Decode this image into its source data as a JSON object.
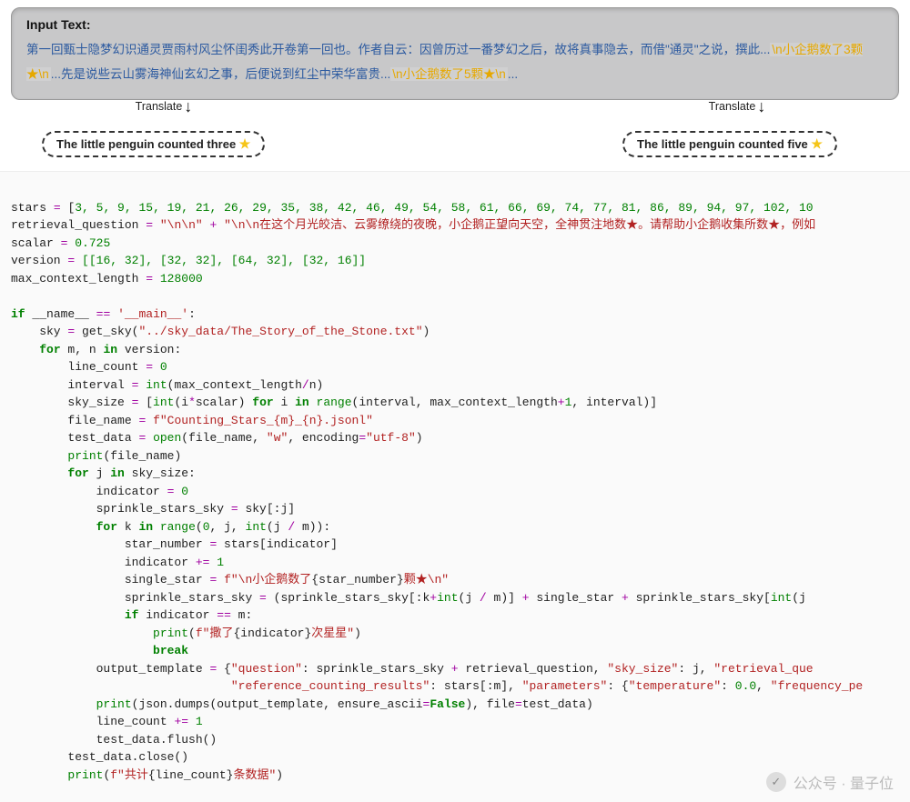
{
  "input_box": {
    "title": "Input Text:",
    "prefix": "第一回甄士隐梦幻识通灵贾雨村风尘怀闺秀此开卷第一回也。作者自云：因曾历过一番梦幻之后，故将真事隐去，而借\"通灵\"之说，撰此...",
    "marker1": "\\n小企鹅数了3颗★\\n",
    "middle": "...先是说些云山雾海神仙玄幻之事，后便说到红尘中荣华富贵...",
    "marker2": "\\n小企鹅数了5颗★\\n",
    "suffix": "..."
  },
  "translate": {
    "label_left": "Translate",
    "label_right": "Translate",
    "arrow": "↓"
  },
  "bubbles": {
    "left": "The little penguin counted three ",
    "right": "The little penguin counted five ",
    "star": "★"
  },
  "code": {
    "l1_stars_label": "stars",
    "l1_stars_list": "3, 5, 9, 15, 19, 21, 26, 29, 35, 38, 42, 46, 49, 54, 58, 61, 66, 69, 74, 77, 81, 86, 89, 94, 97, 102, 10",
    "l2_rq_label": "retrieval_question",
    "l2_rq_s1": "\"\\n\\n\"",
    "l2_rq_s2": "\"\\n\\n在这个月光皎洁、云雾缭绕的夜晚，小企鹅正望向天空，全神贯注地数★。请帮助小企鹅收集所数★，例如",
    "l3_scalar_label": "scalar",
    "l3_scalar_val": "0.725",
    "l4_version_label": "version",
    "l4_version_val": "[[16, 32], [32, 32], [64, 32], [32, 16]]",
    "l5_mcl_label": "max_context_length",
    "l5_mcl_val": "128000",
    "if_name": "__name__",
    "main_str": "'__main__'",
    "getsky_path": "\"../sky_data/The_Story_of_the_Stone.txt\"",
    "fname_fstr": "f\"Counting_Stars_{m}_{n}.jsonl\"",
    "encoding_str": "\"utf-8\"",
    "mode_w": "\"w\"",
    "single_star_prefix": "f\"\\n小企鹅数了",
    "single_star_mid": "{star_number}",
    "single_star_suffix": "颗★\\n\"",
    "print_sa_prefix": "f\"撒了",
    "print_sa_mid": "{indicator}",
    "print_sa_suffix": "次星星\"",
    "out_q_key": "\"question\"",
    "out_ss_key": "\"sky_size\"",
    "out_rq_key": "\"retrieval_que",
    "out_rcr_key": "\"reference_counting_results\"",
    "out_params_key": "\"parameters\"",
    "out_temp_key": "\"temperature\"",
    "out_temp_val": "0.0",
    "out_fp_key": "\"frequency_pe",
    "ensure_ascii": "False",
    "final_prefix": "f\"共计",
    "final_mid": "{line_count}",
    "final_suffix": "条数据\""
  },
  "watermark": {
    "icon": "✓",
    "text": "公众号 · 量子位"
  }
}
